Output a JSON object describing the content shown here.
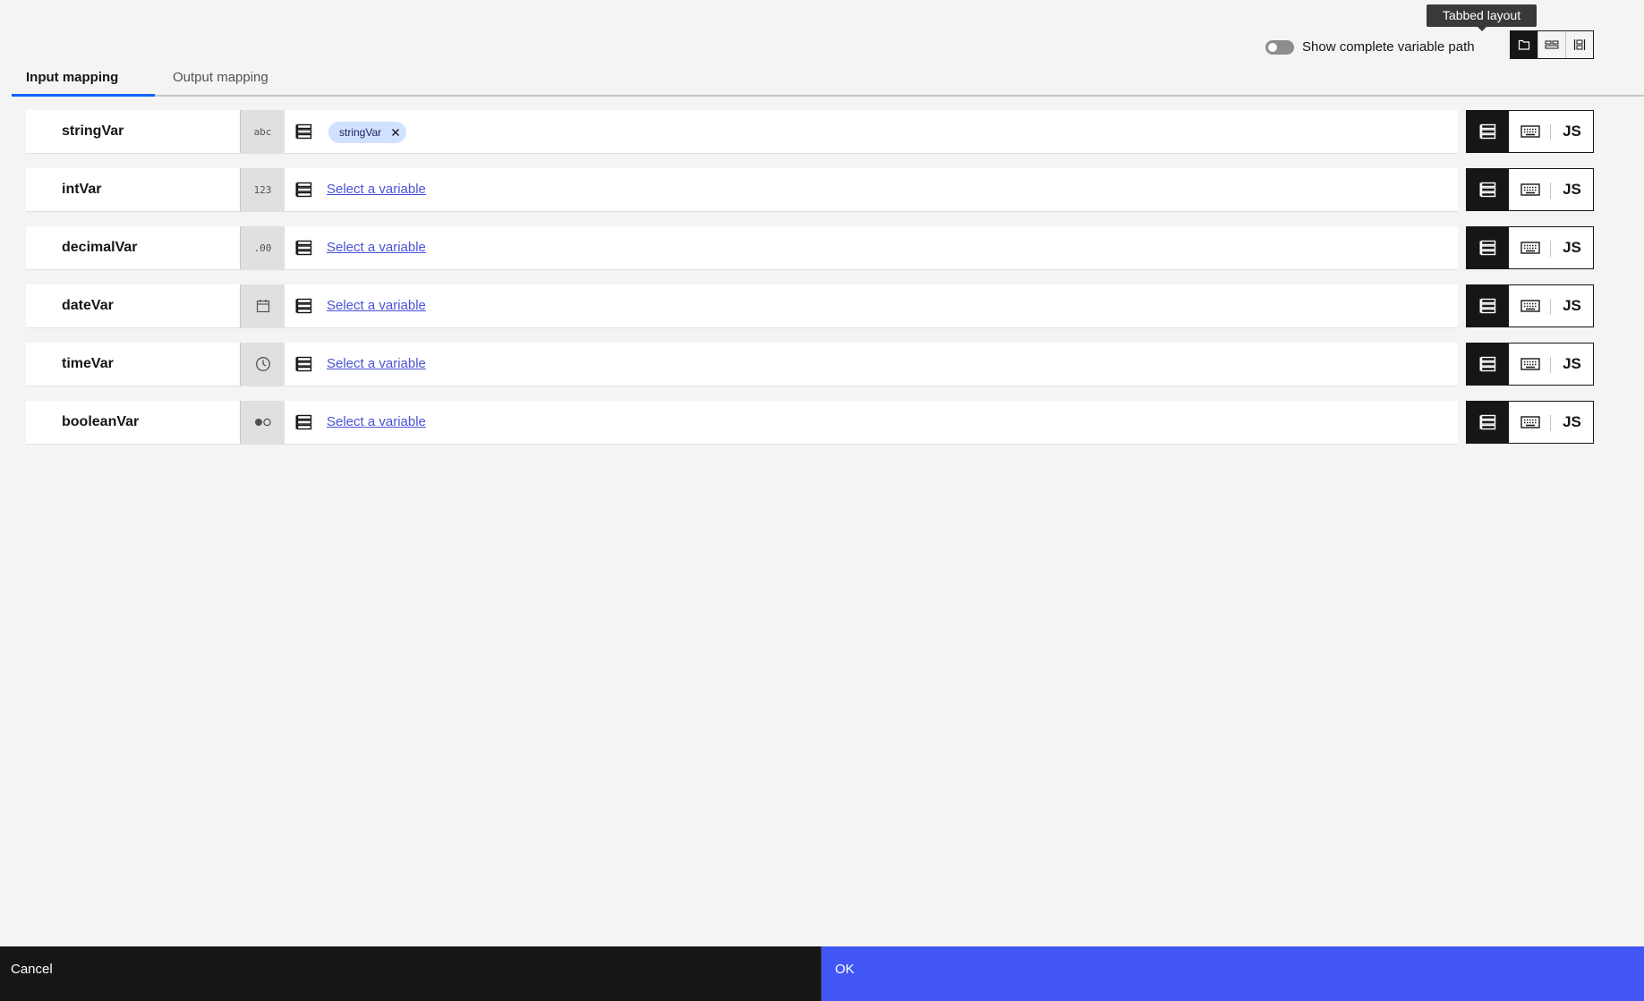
{
  "tooltip": "Tabbed layout",
  "toggle": {
    "label": "Show complete variable path",
    "on": false
  },
  "layout_modes": [
    "tabbed-layout-icon",
    "stacked-layout-icon",
    "side-by-side-layout-icon"
  ],
  "tabs": {
    "input": "Input mapping",
    "output": "Output mapping"
  },
  "rows": [
    {
      "name": "stringVar",
      "type_label": "abc",
      "chip": "stringVar"
    },
    {
      "name": "intVar",
      "type_label": "123",
      "link": "Select a variable"
    },
    {
      "name": "decimalVar",
      "type_label": ".00",
      "link": "Select a variable"
    },
    {
      "name": "dateVar",
      "type_icon": "calendar-icon",
      "link": "Select a variable"
    },
    {
      "name": "timeVar",
      "type_icon": "clock-icon",
      "link": "Select a variable"
    },
    {
      "name": "booleanVar",
      "type_icon": "boolean-toggle-icon",
      "link": "Select a variable"
    }
  ],
  "mode_labels": {
    "js": "JS"
  },
  "footer": {
    "cancel": "Cancel",
    "ok": "OK"
  },
  "colors": {
    "primary": "#4256f4",
    "dark": "#161616",
    "link": "#4a52d6",
    "chip": "#d0e2ff"
  }
}
